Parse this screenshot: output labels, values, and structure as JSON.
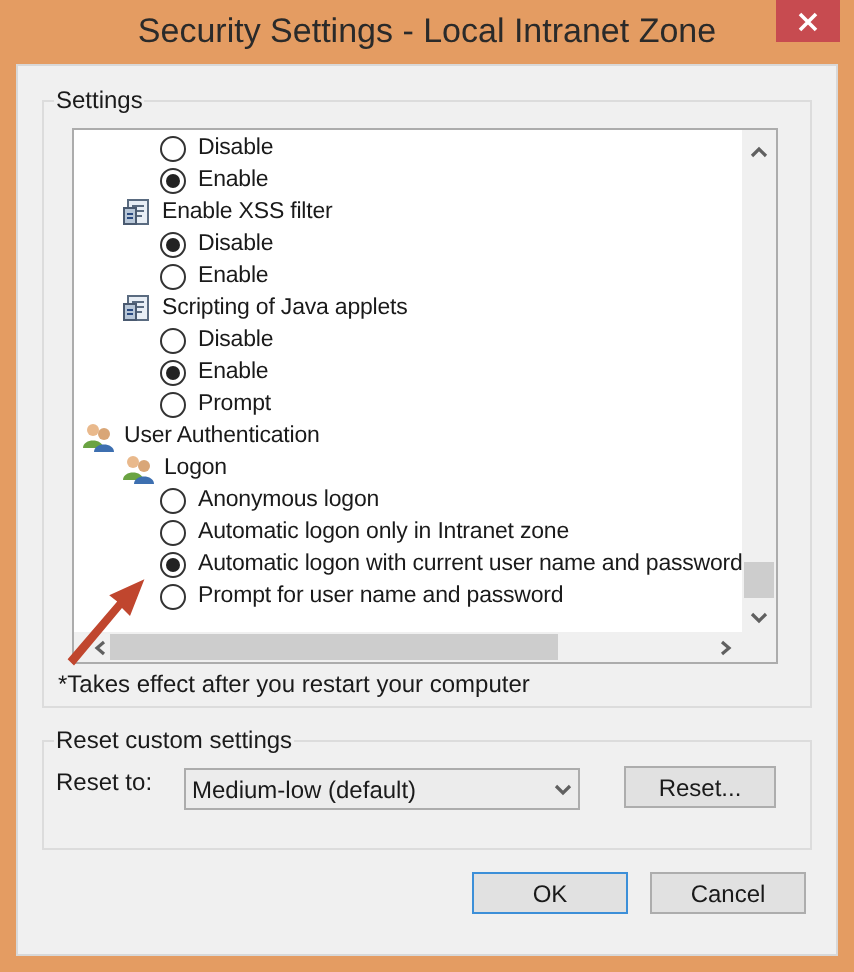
{
  "window": {
    "title": "Security Settings - Local Intranet Zone"
  },
  "settings": {
    "label": "Settings",
    "items": [
      {
        "kind": "radio",
        "label": "Disable",
        "selected": false
      },
      {
        "kind": "radio",
        "label": "Enable",
        "selected": true
      },
      {
        "kind": "setting",
        "label": "Enable XSS filter",
        "children": [
          {
            "kind": "radio",
            "label": "Disable",
            "selected": true
          },
          {
            "kind": "radio",
            "label": "Enable",
            "selected": false
          }
        ]
      },
      {
        "kind": "setting",
        "label": "Scripting of Java applets",
        "children": [
          {
            "kind": "radio",
            "label": "Disable",
            "selected": false
          },
          {
            "kind": "radio",
            "label": "Enable",
            "selected": true
          },
          {
            "kind": "radio",
            "label": "Prompt",
            "selected": false
          }
        ]
      },
      {
        "kind": "category",
        "label": "User Authentication",
        "children": [
          {
            "kind": "setting_users",
            "label": "Logon",
            "children": [
              {
                "kind": "radio",
                "label": "Anonymous logon",
                "selected": false
              },
              {
                "kind": "radio",
                "label": "Automatic logon only in Intranet zone",
                "selected": false
              },
              {
                "kind": "radio",
                "label": "Automatic logon with current user name and password",
                "selected": true
              },
              {
                "kind": "radio",
                "label": "Prompt for user name and password",
                "selected": false
              }
            ]
          }
        ]
      }
    ],
    "note": "*Takes effect after you restart your computer"
  },
  "reset": {
    "label": "Reset custom settings",
    "field_label": "Reset to:",
    "value": "Medium-low (default)",
    "button": "Reset..."
  },
  "buttons": [
    "OK",
    "Cancel"
  ]
}
